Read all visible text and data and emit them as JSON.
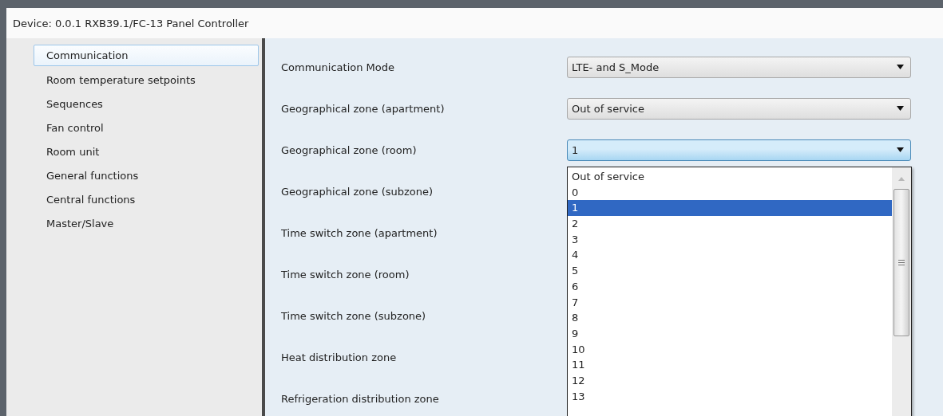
{
  "header": {
    "title": "Device: 0.0.1  RXB39.1/FC-13 Panel Controller"
  },
  "sidebar": {
    "items": [
      {
        "label": "Communication",
        "selected": true
      },
      {
        "label": "Room temperature setpoints",
        "selected": false
      },
      {
        "label": "Sequences",
        "selected": false
      },
      {
        "label": "Fan control",
        "selected": false
      },
      {
        "label": "Room unit",
        "selected": false
      },
      {
        "label": "General functions",
        "selected": false
      },
      {
        "label": "Central functions",
        "selected": false
      },
      {
        "label": "Master/Slave",
        "selected": false
      }
    ]
  },
  "settings": [
    {
      "label": "Communication Mode",
      "value": "LTE- and S_Mode",
      "open": false
    },
    {
      "label": "Geographical zone (apartment)",
      "value": "Out of service",
      "open": false
    },
    {
      "label": "Geographical zone (room)",
      "value": "1",
      "open": true
    },
    {
      "label": "Geographical zone (subzone)"
    },
    {
      "label": "Time switch zone (apartment)"
    },
    {
      "label": "Time switch zone (room)"
    },
    {
      "label": "Time switch zone (subzone)"
    },
    {
      "label": "Heat distribution zone"
    },
    {
      "label": "Refrigeration distribution zone"
    }
  ],
  "dropdown_list": {
    "options": [
      {
        "label": "Out of service",
        "selected": false
      },
      {
        "label": "0",
        "selected": false
      },
      {
        "label": "1",
        "selected": true
      },
      {
        "label": "2",
        "selected": false
      },
      {
        "label": "3",
        "selected": false
      },
      {
        "label": "4",
        "selected": false
      },
      {
        "label": "5",
        "selected": false
      },
      {
        "label": "6",
        "selected": false
      },
      {
        "label": "7",
        "selected": false
      },
      {
        "label": "8",
        "selected": false
      },
      {
        "label": "9",
        "selected": false
      },
      {
        "label": "10",
        "selected": false
      },
      {
        "label": "11",
        "selected": false
      },
      {
        "label": "12",
        "selected": false
      },
      {
        "label": "13",
        "selected": false
      }
    ]
  }
}
